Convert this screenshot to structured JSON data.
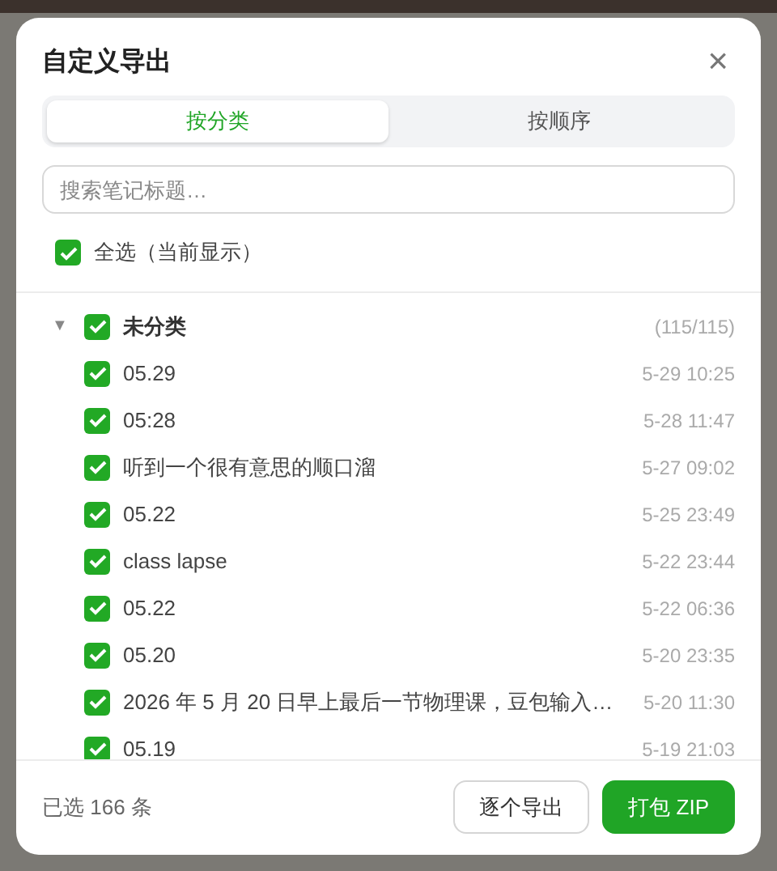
{
  "dialog": {
    "title": "自定义导出",
    "close": "×"
  },
  "tabs": [
    {
      "label": "按分类",
      "selected": true
    },
    {
      "label": "按顺序",
      "selected": false
    }
  ],
  "search": {
    "placeholder": "搜索笔记标题…"
  },
  "select_all": {
    "label": "全选（当前显示）",
    "checked": true
  },
  "groups": [
    {
      "name": "未分类",
      "count": "(115/115)",
      "checked": true,
      "expanded": true,
      "toggle": "▼",
      "children": [
        {
          "title": "05.29",
          "time": "5-29 10:25",
          "checked": true
        },
        {
          "title": "05:28",
          "time": "5-28 11:47",
          "checked": true
        },
        {
          "title": "听到一个很有意思的顺口溜",
          "time": "5-27 09:02",
          "checked": true
        },
        {
          "title": "05.22",
          "time": "5-25 23:49",
          "checked": true
        },
        {
          "title": "class lapse",
          "time": "5-22 23:44",
          "checked": true
        },
        {
          "title": "05.22",
          "time": "5-22 06:36",
          "checked": true
        },
        {
          "title": "05.20",
          "time": "5-20 23:35",
          "checked": true
        },
        {
          "title": "2026 年 5 月 20 日早上最后一节物理课，豆包输入…",
          "time": "5-20 11:30",
          "checked": true
        },
        {
          "title": "05.19",
          "time": "5-19 21:03",
          "checked": true
        }
      ]
    }
  ],
  "footer": {
    "summary": "已选 166 条",
    "buttons": [
      {
        "label": "逐个导出",
        "kind": "secondary"
      },
      {
        "label": "打包 ZIP",
        "kind": "primary"
      }
    ]
  }
}
